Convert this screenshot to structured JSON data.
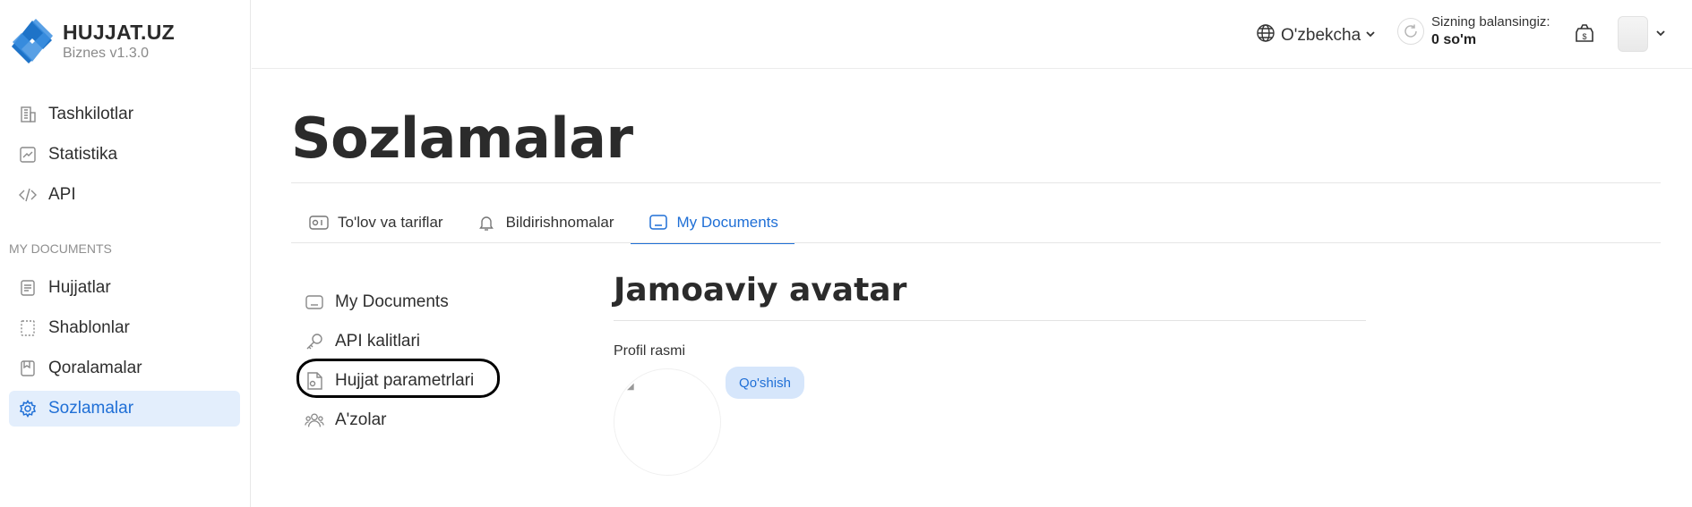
{
  "brand": {
    "title": "HUJJAT.UZ",
    "subtitle": "Biznes v1.3.0"
  },
  "sidebar": {
    "items": [
      {
        "label": "Tashkilotlar",
        "icon": "building-icon"
      },
      {
        "label": "Statistika",
        "icon": "chart-icon"
      },
      {
        "label": "API",
        "icon": "code-icon"
      }
    ],
    "section_label": "MY DOCUMENTS",
    "section_items": [
      {
        "label": "Hujjatlar",
        "icon": "document-icon"
      },
      {
        "label": "Shablonlar",
        "icon": "template-icon"
      },
      {
        "label": "Qoralamalar",
        "icon": "draft-icon"
      },
      {
        "label": "Sozlamalar",
        "icon": "settings-icon",
        "active": true
      }
    ]
  },
  "header": {
    "language": "O'zbekcha",
    "balance_caption": "Sizning balansingiz:",
    "balance_amount": "0 so'm"
  },
  "page": {
    "title": "Sozlamalar",
    "tabs": [
      {
        "label": "To'lov va tariflar",
        "icon": "wallet-icon"
      },
      {
        "label": "Bildirishnomalar",
        "icon": "bell-icon"
      },
      {
        "label": "My Documents",
        "icon": "monitor-icon",
        "active": true
      }
    ],
    "subnav": [
      {
        "label": "My Documents",
        "icon": "monitor-icon"
      },
      {
        "label": "API kalitlari",
        "icon": "key-icon"
      },
      {
        "label": "Hujjat parametrlari",
        "icon": "file-settings-icon",
        "highlighted": true
      },
      {
        "label": "A'zolar",
        "icon": "users-icon"
      }
    ],
    "content": {
      "heading": "Jamoaviy avatar",
      "field_label": "Profil rasmi",
      "add_button": "Qo'shish"
    }
  },
  "colors": {
    "accent": "#1f6fd6",
    "active_bg": "#e3eefc",
    "button_bg": "#d6e6fb",
    "brand_blue": "#1e73c8"
  }
}
